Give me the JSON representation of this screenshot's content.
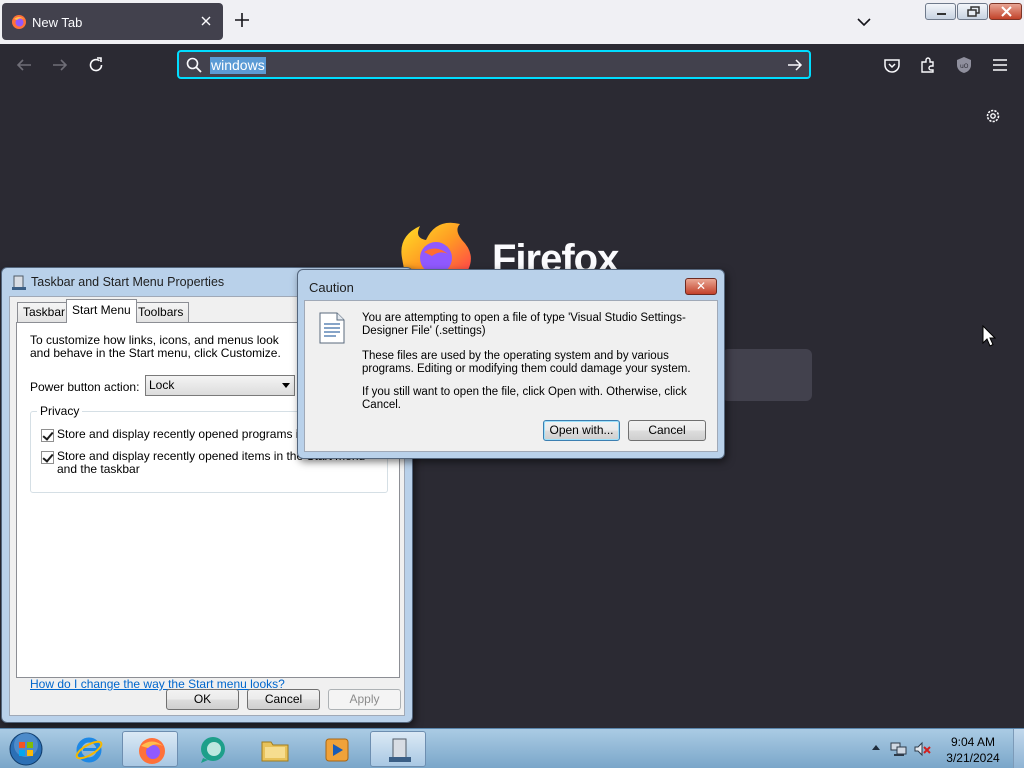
{
  "browser": {
    "tab": {
      "title": "New Tab"
    },
    "urlbar": {
      "value": "windows"
    },
    "brand_wordmark": "Firefox"
  },
  "taskbar_props": {
    "title": "Taskbar and Start Menu Properties",
    "tabs": [
      "Taskbar",
      "Start Menu",
      "Toolbars"
    ],
    "selected_tab": "Start Menu",
    "intro": "To customize how links, icons, and menus look and behave in the Start menu, click Customize.",
    "power_button_label": "Power button action:",
    "power_button_value": "Lock",
    "privacy_legend": "Privacy",
    "checkbox1": "Store and display recently opened programs in the",
    "checkbox2": "Store and display recently opened items in the Start menu and the taskbar",
    "help_link": "How do I change the way the Start menu looks?",
    "ok": "OK",
    "cancel": "Cancel",
    "apply": "Apply"
  },
  "caution": {
    "title": "Caution",
    "message1": "You are attempting to open a file of type 'Visual Studio Settings-Designer File' (.settings)",
    "message2": "These files are used by the operating system and by various programs. Editing or modifying them could damage your system.",
    "message3": "If you still want to open the file, click Open with. Otherwise, click Cancel.",
    "open_with": "Open with...",
    "cancel": "Cancel"
  },
  "taskbar": {
    "items": [
      "start-orb",
      "internet-explorer-icon",
      "firefox-icon",
      "chat-app-icon",
      "file-explorer-icon",
      "media-player-icon",
      "taskbar-properties-icon"
    ],
    "clock_time": "9:04 AM",
    "clock_date": "3/21/2024"
  },
  "colors": {
    "firefox_bg": "#2b2a33",
    "urlbar_focus": "#00ddff",
    "link": "#0066cc",
    "taskbar": "#aacbe4"
  }
}
